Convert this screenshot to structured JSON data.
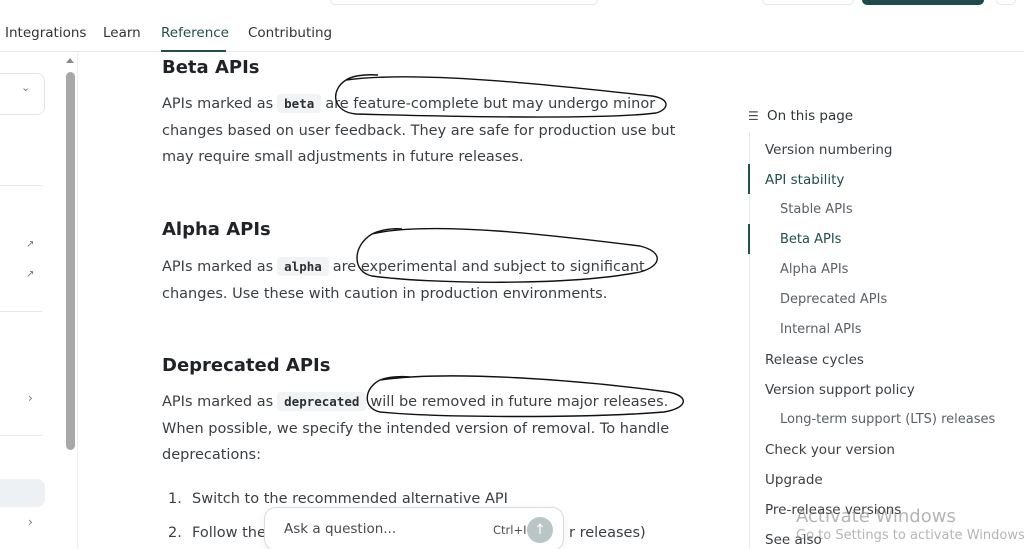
{
  "nav": {
    "items": [
      {
        "label": "Integrations"
      },
      {
        "label": "Learn"
      },
      {
        "label": "Reference"
      },
      {
        "label": "Contributing"
      }
    ],
    "active": "Reference"
  },
  "main": {
    "sections": [
      {
        "heading": "Beta APIs",
        "pre": "APIs marked as",
        "code": "beta",
        "post_line1": "are feature-complete but may undergo minor",
        "rest": "changes based on user feedback. They are safe for production use but may require small adjustments in future releases."
      },
      {
        "heading": "Alpha APIs",
        "pre": "APIs marked as",
        "code": "alpha",
        "post_line1": "are experimental and subject to significant",
        "rest": "changes. Use these with caution in production environments."
      },
      {
        "heading": "Deprecated APIs",
        "pre": "APIs marked as",
        "code": "deprecated",
        "post_line1": "will be removed in future major releases.",
        "rest": "When possible, we specify the intended version of removal. To handle deprecations:"
      }
    ],
    "steps": [
      {
        "num": "1.",
        "text": "Switch to the recommended alternative API"
      },
      {
        "num": "2.",
        "text": "Follow the",
        "tail": "r releases)"
      }
    ]
  },
  "toc": {
    "title": "On this page",
    "items": [
      {
        "label": "Version numbering",
        "level": 1
      },
      {
        "label": "API stability",
        "level": 1
      },
      {
        "label": "Stable APIs",
        "level": 2
      },
      {
        "label": "Beta APIs",
        "level": 2
      },
      {
        "label": "Alpha APIs",
        "level": 2
      },
      {
        "label": "Deprecated APIs",
        "level": 2
      },
      {
        "label": "Internal APIs",
        "level": 2
      },
      {
        "label": "Release cycles",
        "level": 1
      },
      {
        "label": "Version support policy",
        "level": 1
      },
      {
        "label": "Long-term support (LTS) releases",
        "level": 2
      },
      {
        "label": "Check your version",
        "level": 1
      },
      {
        "label": "Upgrade",
        "level": 1
      },
      {
        "label": "Pre-release versions",
        "level": 1
      },
      {
        "label": "See also",
        "level": 1
      }
    ]
  },
  "ask": {
    "placeholder": "Ask a question...",
    "shortcut": "Ctrl+I"
  },
  "watermark": {
    "title": "Activate Windows",
    "subtitle": "Go to Settings to activate Windows."
  },
  "colors": {
    "accent": "#214e4f",
    "scribble": "#111111"
  }
}
